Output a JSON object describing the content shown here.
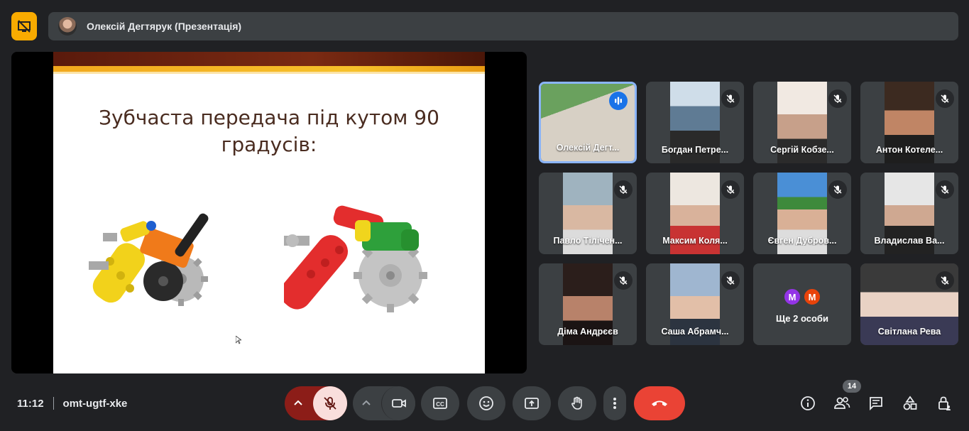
{
  "presentation_bar": {
    "title": "Олексій Дегтярук (Презентація)",
    "badge_icon": "presentation-off-icon",
    "badge_color": "#f9ab00"
  },
  "slide": {
    "title": "Зубчаста передача під кутом 90 градусів:"
  },
  "participants": [
    {
      "name": "Олексій Дегт...",
      "speaking": true,
      "muted": false
    },
    {
      "name": "Богдан Петре...",
      "speaking": false,
      "muted": true
    },
    {
      "name": "Сергій Кобзе...",
      "speaking": false,
      "muted": true
    },
    {
      "name": "Антон Котеле...",
      "speaking": false,
      "muted": true
    },
    {
      "name": "Павло Тілічен...",
      "speaking": false,
      "muted": true
    },
    {
      "name": "Максим Коля...",
      "speaking": false,
      "muted": true
    },
    {
      "name": "Євген Дубров...",
      "speaking": false,
      "muted": true
    },
    {
      "name": "Владислав Ва...",
      "speaking": false,
      "muted": true
    },
    {
      "name": "Діма Андрєєв",
      "speaking": false,
      "muted": true
    },
    {
      "name": "Саша Абрамч...",
      "speaking": false,
      "muted": true
    },
    {
      "name": "Світлана Рева",
      "speaking": false,
      "muted": true
    }
  ],
  "more_people": {
    "label": "Ще 2 особи",
    "avatars": [
      {
        "letter": "М",
        "color": "#9334e6"
      },
      {
        "letter": "М",
        "color": "#e8430a"
      }
    ]
  },
  "meeting": {
    "time": "11:12",
    "code": "omt-ugtf-xke"
  },
  "controls": {
    "people_count": "14",
    "end_call_color": "#ea4335",
    "mic_off_color": "#f9dedc"
  }
}
